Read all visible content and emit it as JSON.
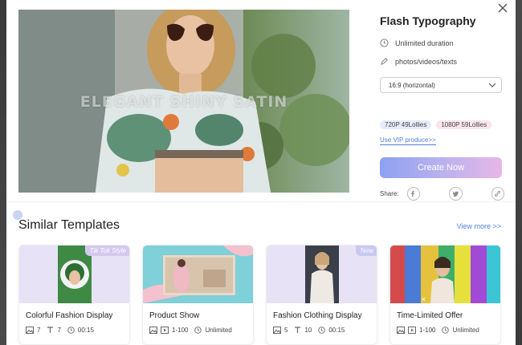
{
  "modal": {
    "title": "Flash Typography",
    "watermark": "ELEGANT SHINY SATIN",
    "duration": "Unlimited duration",
    "media": "photos/videos/texts",
    "aspect_select": "16:9 (horizontal)",
    "prices": [
      "720P 49Lollies",
      "1080P 59Lollies"
    ],
    "vip_link": "Use VIP produce>>",
    "create_button": "Create Now",
    "share_label": "Share:",
    "icons": [
      "close-icon",
      "clock-icon",
      "pencil-icon",
      "chevron-down-icon",
      "facebook-icon",
      "twitter-icon",
      "link-icon"
    ]
  },
  "similar": {
    "title": "Similar Templates",
    "view_more": "View more >>",
    "cards": [
      {
        "title": "Colorful Fashion Display",
        "tag": "Tik Tok Style",
        "images": "7",
        "texts": "7",
        "duration": "00:15",
        "meta_type": "counts"
      },
      {
        "title": "Product Show",
        "tag": "",
        "images": "",
        "range": "1-100",
        "duration": "Unlimited",
        "meta_type": "range"
      },
      {
        "title": "Fashion Clothing Display",
        "tag": "New",
        "images": "5",
        "texts": "10",
        "duration": "00:15",
        "meta_type": "counts"
      },
      {
        "title": "Time-Limited Offer",
        "tag": "",
        "range": "1-100",
        "duration": "Unlimited",
        "meta_type": "range"
      }
    ]
  },
  "colors": {
    "accent": "#4f7fe0",
    "button_gradient": [
      "#8ea0f2",
      "#e7b7e8"
    ],
    "tag_purple": "#d3c8ee"
  }
}
